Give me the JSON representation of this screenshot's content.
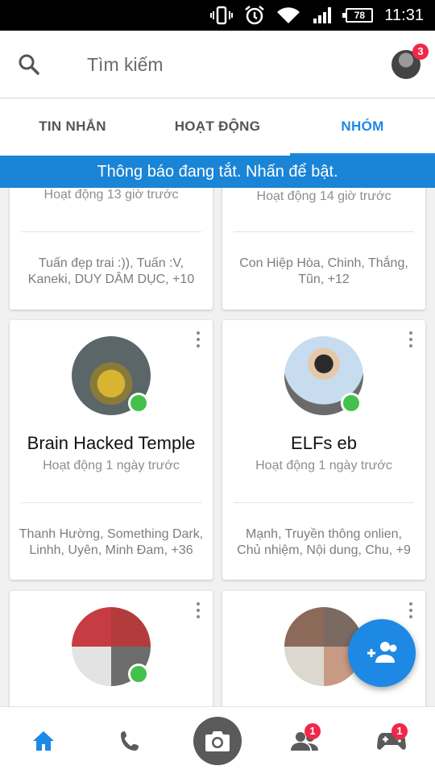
{
  "status_bar": {
    "time": "11:31",
    "battery": "78"
  },
  "search": {
    "placeholder": "Tìm kiếm"
  },
  "profile": {
    "badge_count": "3"
  },
  "tabs": [
    {
      "label": "TIN NHẮN",
      "active": false
    },
    {
      "label": "HOẠT ĐỘNG",
      "active": false
    },
    {
      "label": "NHÓM",
      "active": true
    }
  ],
  "banner": {
    "text": "Thông báo đang tắt. Nhấn để bật."
  },
  "groups": [
    {
      "name": "",
      "activity": "Hoạt động 13 giờ trước",
      "members": [
        "Tuấn đẹp trai :)), Tuấn :V,",
        "Kaneki, DUY DÂM DỤC, +10"
      ]
    },
    {
      "name": "",
      "activity": "Hoạt động 14 giờ trước",
      "members": [
        "Con Hiệp Hòa, Chinh, Thắng,",
        "Tũn, +12"
      ]
    },
    {
      "name": "Brain Hacked Temple",
      "activity": "Hoạt động 1 ngày trước",
      "members": [
        "Thanh Hường, Something Dark,",
        "Linhh, Uyên, Minh Đam, +36"
      ]
    },
    {
      "name": "ELFs eb",
      "activity": "Hoạt động 1 ngày trước",
      "members": [
        "Mạnh, Truyền thông onlien,",
        "Chủ nhiệm, Nội dung, Chu, +9"
      ]
    }
  ],
  "bottom_nav": {
    "items": [
      "home-icon",
      "phone-icon",
      "camera-icon",
      "people-icon",
      "games-icon"
    ],
    "people_badge": "1",
    "games_badge": "1"
  },
  "colors": {
    "accent": "#1e88e5",
    "banner": "#1a84d6",
    "online": "#44c04c",
    "badge": "#f02849"
  }
}
